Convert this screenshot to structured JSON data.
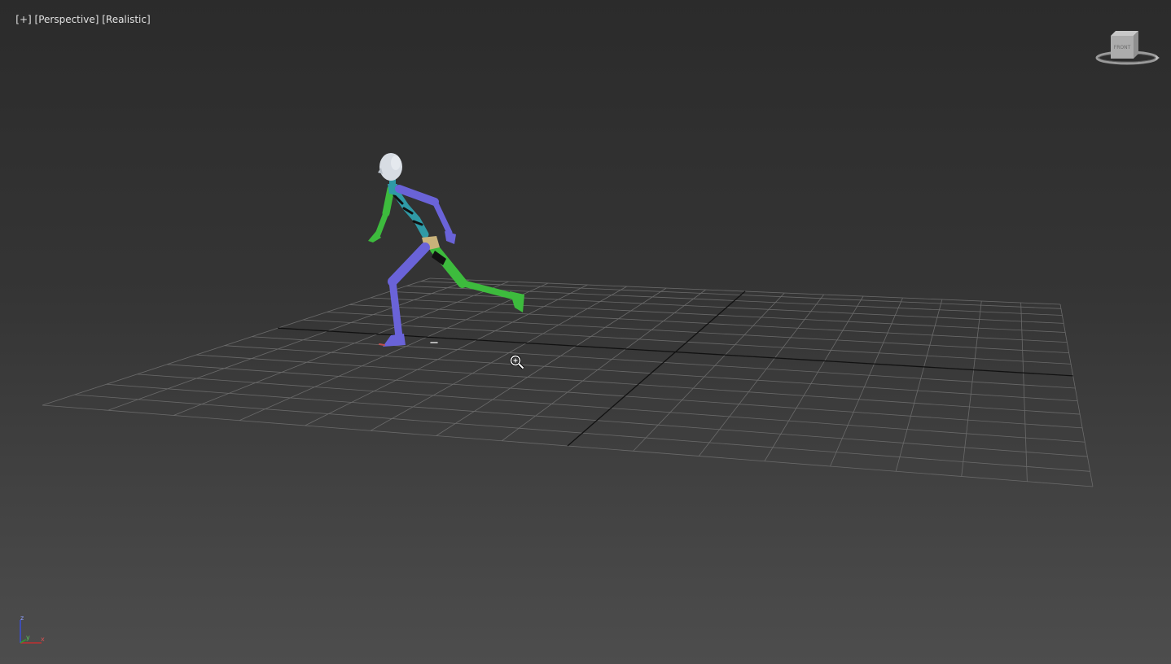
{
  "viewport": {
    "label_plus": "[+]",
    "label_view": "[Perspective]",
    "label_shading": "[Realistic]"
  },
  "viewcube": {
    "face_label": "FRONT",
    "icon": "viewcube-icon"
  },
  "axis_tripod": {
    "z": "z",
    "y": "y",
    "x": "x"
  },
  "cursor": {
    "icon": "zoom-cursor-icon"
  },
  "colors": {
    "background_top": "#2b2b2b",
    "background_bottom": "#4d4d4d",
    "grid_line": "#6a6a6a",
    "grid_axis": "#111111",
    "biped_left": "#3dbb3d",
    "biped_right": "#6a63d8",
    "biped_spine": "#2f9aa6",
    "head": "#d7dce3",
    "pelvis": "#c9b27a"
  }
}
